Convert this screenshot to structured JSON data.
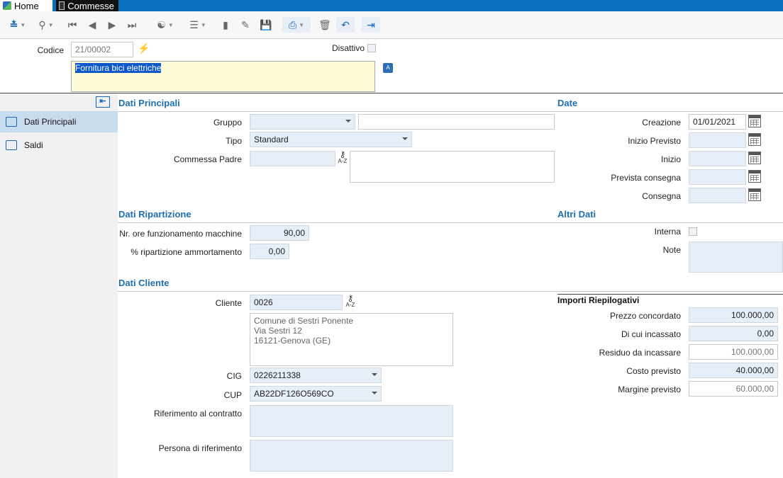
{
  "tabs": [
    {
      "label": "Home",
      "icon": "home-icon"
    },
    {
      "label": "Commesse",
      "icon": "window-icon"
    }
  ],
  "toolbar": {
    "icons": [
      "expand-icon",
      "search-icon",
      "first-icon",
      "prev-icon",
      "next-icon",
      "last-icon",
      "attach-icon",
      "database-icon",
      "new-document-icon",
      "edit-icon",
      "save-icon",
      "print-icon",
      "delete-icon",
      "undo-icon",
      "exit-icon"
    ]
  },
  "header": {
    "codice_label": "Codice",
    "codice_value": "21/00002",
    "disattivo_label": "Disattivo",
    "description": "Fornitura bici elettriche"
  },
  "sidebar": {
    "items": [
      {
        "label": "Dati Principali",
        "selected": true
      },
      {
        "label": "Saldi",
        "selected": false
      }
    ]
  },
  "dati_principali": {
    "title": "Dati Principali",
    "gruppo_label": "Gruppo",
    "gruppo_value": "",
    "tipo_label": "Tipo",
    "tipo_value": "Standard",
    "commessa_padre_label": "Commessa Padre",
    "commessa_padre_value": "",
    "key_icon_text": "A-Z"
  },
  "date": {
    "title": "Date",
    "creazione_label": "Creazione",
    "creazione_value": "01/01/2021",
    "inizio_previsto_label": "Inizio Previsto",
    "inizio_label": "Inizio",
    "prevista_consegna_label": "Prevista consegna",
    "consegna_label": "Consegna"
  },
  "dati_ripartizione": {
    "title": "Dati Ripartizione",
    "ore_label": "Nr. ore funzionamento macchine",
    "ore_value": "90,00",
    "ammortamento_label": "% ripartizione ammortamento",
    "ammortamento_value": "0,00"
  },
  "altri_dati": {
    "title": "Altri Dati",
    "interna_label": "Interna",
    "note_label": "Note"
  },
  "dati_cliente": {
    "title": "Dati Cliente",
    "cliente_label": "Cliente",
    "cliente_value": "0026",
    "address_line1": "Comune di Sestri Ponente",
    "address_line2": "Via Sestri 12",
    "address_line3": "16121-Genova (GE)",
    "cig_label": "CIG",
    "cig_value": "0226211338",
    "cup_label": "CUP",
    "cup_value": "AB22DF126O569CO",
    "riferimento_label": "Riferimento al contratto",
    "persona_label": "Persona di riferimento"
  },
  "importi": {
    "title": "Importi Riepilogativi",
    "prezzo_label": "Prezzo concordato",
    "prezzo_value": "100.000,00",
    "incassato_label": "Di cui incassato",
    "incassato_value": "0,00",
    "residuo_label": "Residuo da incassare",
    "residuo_value": "100.000,00",
    "costo_label": "Costo previsto",
    "costo_value": "40.000,00",
    "margine_label": "Margine previsto",
    "margine_value": "60.000,00"
  },
  "colors": {
    "accent": "#1f6fb0",
    "topbar": "#0a6fbd",
    "field_blue": "#e6eef8",
    "description_bg": "#fefcd8",
    "sidebar_selected": "#c9dcee"
  }
}
